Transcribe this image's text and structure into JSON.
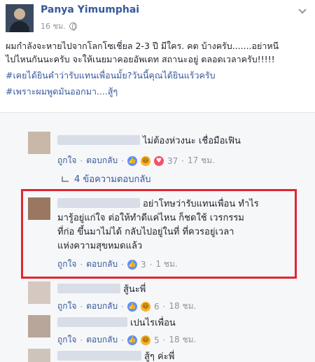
{
  "post": {
    "author": "Panya Yimumphai",
    "time": "16 ชม.",
    "text_line1": "ผมกำลังจะหายไปจากโลกโซเชี่ยล 2-3 ปี มีใคร. คต บ้างครับ.......อย่าหนี",
    "text_line2": "ไปไหนกันนะครับ จะให้เนยมาคอยอัพเดท สถานะอยู่ ตลอดเวลาครับ!!!!!",
    "hashtag1": "#เคยได้ยินคำว่ารับแทนเพื่อนมั้ย?วันนี้คุณได้ยินแร้วครับ",
    "hashtag2": "#เพราะผมพูดมันออกมา....สู้ๆ"
  },
  "comments": [
    {
      "text": "ไม่ต้องห่วงนะ เชื่อมือเฟิน",
      "like": "ถูกใจ",
      "reply": "ตอบกลับ",
      "count": "37",
      "age": "17 ชม."
    },
    {
      "replies_link": "4 ข้อความตอบกลับ"
    },
    {
      "line1": "อย่าโทษว่ารับแทนเพื่อน ทำไร",
      "line2": "มารู้อยู่แก่ใจ ต่อให้ทำดีแค่ไหน ก็ชดใช้ เวรกรรม",
      "line3": "ที่ก่อ ขึ้นมาไม่ได้ กลับไปอยู่ในที่ ที่ควรอยู่เวลา",
      "line4": "แห่งความสุขหมดแล้ว",
      "like": "ถูกใจ",
      "reply": "ตอบกลับ",
      "count": "3",
      "age": "1 ชม."
    },
    {
      "text": "สู้นะพี่",
      "like": "ถูกใจ",
      "reply": "ตอบกลับ",
      "count": "6",
      "age": "18 ชม."
    },
    {
      "text": "เปนไรเพื่อน",
      "like": "ถูกใจ",
      "reply": "ตอบกลับ",
      "count": "5",
      "age": "18 ชม."
    },
    {
      "text": "สู้ๆ ค่ะพี่"
    }
  ],
  "colors": {
    "link": "#365899",
    "highlight": "#e0262f",
    "meta": "#90949c"
  },
  "icons": {
    "like": "thumbs-up-icon",
    "haha": "haha-icon",
    "love": "love-icon"
  }
}
